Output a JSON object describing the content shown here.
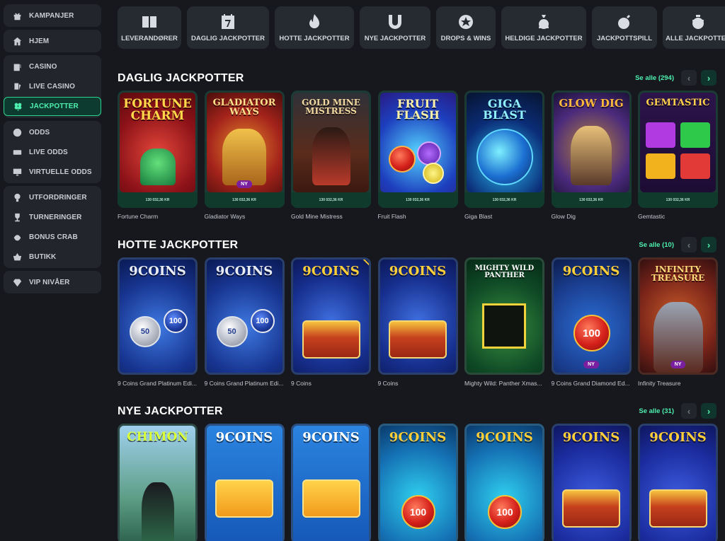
{
  "sidebar": {
    "groups": [
      [
        {
          "label": "KAMPANJER",
          "icon": "gift-icon"
        }
      ],
      [
        {
          "label": "HJEM",
          "icon": "home-icon"
        }
      ],
      [
        {
          "label": "CASINO",
          "icon": "slot-machine-icon"
        },
        {
          "label": "LIVE CASINO",
          "icon": "cards-icon"
        },
        {
          "label": "JACKPOTTER",
          "icon": "clover-icon",
          "active": true
        }
      ],
      [
        {
          "label": "ODDS",
          "icon": "football-icon"
        },
        {
          "label": "LIVE ODDS",
          "icon": "live-icon"
        },
        {
          "label": "VIRTUELLE ODDS",
          "icon": "monitor-icon"
        }
      ],
      [
        {
          "label": "UTFORDRINGER",
          "icon": "challenge-icon"
        },
        {
          "label": "TURNERINGER",
          "icon": "trophy-icon"
        },
        {
          "label": "BONUS CRAB",
          "icon": "crab-icon"
        },
        {
          "label": "BUTIKK",
          "icon": "basket-icon"
        }
      ],
      [
        {
          "label": "VIP NIVÅER",
          "icon": "diamond-icon"
        }
      ]
    ]
  },
  "categories": [
    {
      "label": "LEVERANDØRER",
      "icon": "book-icon"
    },
    {
      "label": "DAGLIG JACKPOTTER",
      "icon": "calendar-7-icon"
    },
    {
      "label": "HOTTE JACKPOTTER",
      "icon": "flame-icon"
    },
    {
      "label": "NYE JACKPOTTER",
      "icon": "horseshoe-icon"
    },
    {
      "label": "DROPS & WINS",
      "icon": "drops-wins-icon"
    },
    {
      "label": "HELDIGE JACKPOTTER",
      "icon": "money-bag-icon"
    },
    {
      "label": "JACKPOTTSPILL",
      "icon": "bomb-icon"
    },
    {
      "label": "ALLE JACKPOTTER",
      "icon": "pot-icon"
    }
  ],
  "sections": [
    {
      "title": "DAGLIG JACKPOTTER",
      "see_all": "Se alle (294)",
      "games": [
        {
          "name": "Fortune Charm",
          "art_title": "FORTUNE CHARM",
          "jackpot": "130 032,36 KR"
        },
        {
          "name": "Gladiator Ways",
          "art_title": "GLADIATOR WAYS",
          "jackpot": "130 032,36 KR",
          "badge": "NY"
        },
        {
          "name": "Gold Mine Mistress",
          "art_title": "GOLD MINE MISTRESS",
          "jackpot": "130 032,36 KR"
        },
        {
          "name": "Fruit Flash",
          "art_title": "FRUIT FLASH",
          "jackpot": "130 032,36 KR"
        },
        {
          "name": "Giga Blast",
          "art_title": "GIGA BLAST",
          "jackpot": "130 032,36 KR"
        },
        {
          "name": "Glow Dig",
          "art_title": "GLOW DIG",
          "jackpot": "130 032,36 KR"
        },
        {
          "name": "Gemtastic",
          "art_title": "GEMTASTIC",
          "jackpot": "130 032,36 KR"
        }
      ]
    },
    {
      "title": "HOTTE JACKPOTTER",
      "see_all": "Se alle (10)",
      "games": [
        {
          "name": "9 Coins Grand Platinum Edi...",
          "art_title": "9COINS",
          "coin_a": "50",
          "coin_b": "100"
        },
        {
          "name": "9 Coins Grand Platinum Edi...",
          "art_title": "9COINS",
          "coin_a": "50",
          "coin_b": "100"
        },
        {
          "name": "9 Coins",
          "art_title": "9COINS"
        },
        {
          "name": "9 Coins",
          "art_title": "9COINS"
        },
        {
          "name": "Mighty Wild: Panther Xmas...",
          "art_title": "MIGHTY WILD PANTHER"
        },
        {
          "name": "9 Coins Grand Diamond Ed...",
          "art_title": "9COINS",
          "coin_a": "100",
          "badge": "NY"
        },
        {
          "name": "Infinity Treasure",
          "art_title": "INFINITY TREASURE",
          "badge": "NY"
        }
      ]
    },
    {
      "title": "NYE JACKPOTTER",
      "see_all": "Se alle (31)",
      "games": [
        {
          "art_title": "CHIMON"
        },
        {
          "art_title": "9COINS"
        },
        {
          "art_title": "9COINS"
        },
        {
          "art_title": "9COINS",
          "coin_a": "100"
        },
        {
          "art_title": "9COINS",
          "coin_a": "100"
        },
        {
          "art_title": "9COINS"
        },
        {
          "art_title": "9COINS"
        }
      ]
    }
  ],
  "colors": {
    "accent": "#4ef0b0",
    "background": "#16181d",
    "panel": "#22252b"
  }
}
